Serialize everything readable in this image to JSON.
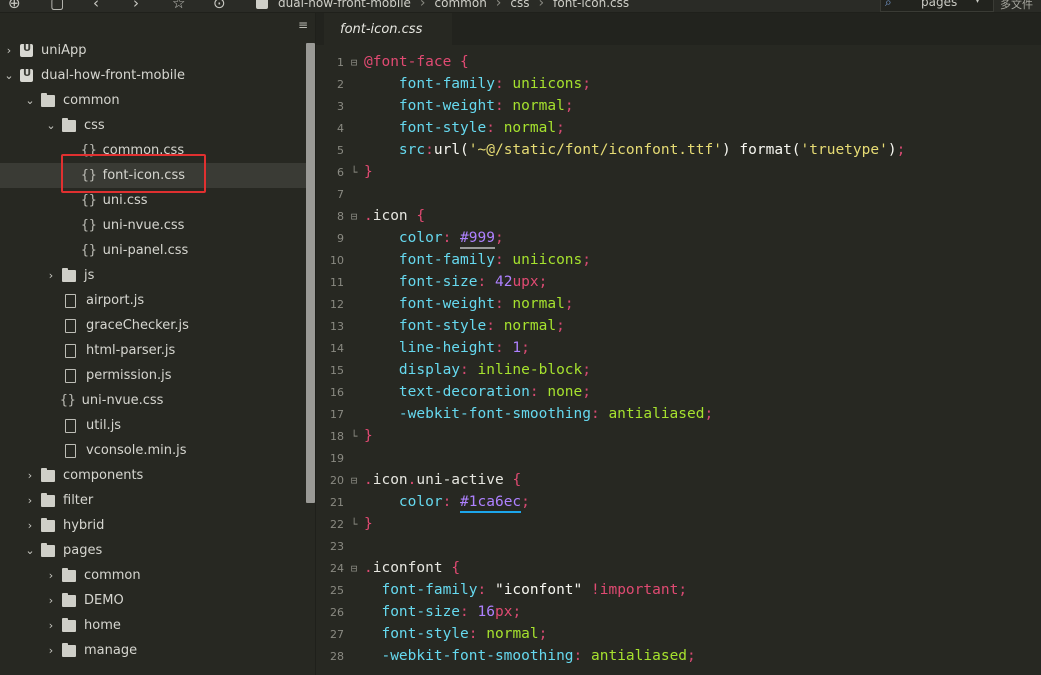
{
  "toolbar": {
    "breadcrumbs": [
      "dual-how-front-mobile",
      "common",
      "css",
      "font-icon.css"
    ],
    "search_scope": "pages",
    "right_label": "多文件搜"
  },
  "sidebar": {
    "tree": [
      {
        "label": "uniApp",
        "type": "project",
        "arrow": "›"
      },
      {
        "label": "dual-how-front-mobile",
        "type": "project",
        "arrow": "⌄"
      },
      {
        "label": "common",
        "type": "folder",
        "arrow": "⌄"
      },
      {
        "label": "css",
        "type": "folder",
        "arrow": "⌄"
      },
      {
        "label": "common.css",
        "type": "css"
      },
      {
        "label": "font-icon.css",
        "type": "css",
        "selected": true
      },
      {
        "label": "uni.css",
        "type": "css"
      },
      {
        "label": "uni-nvue.css",
        "type": "css"
      },
      {
        "label": "uni-panel.css",
        "type": "css"
      },
      {
        "label": "js",
        "type": "folder",
        "arrow": "›"
      },
      {
        "label": "airport.js",
        "type": "file"
      },
      {
        "label": "graceChecker.js",
        "type": "file"
      },
      {
        "label": "html-parser.js",
        "type": "file"
      },
      {
        "label": "permission.js",
        "type": "file"
      },
      {
        "label": "uni-nvue.css",
        "type": "css"
      },
      {
        "label": "util.js",
        "type": "file"
      },
      {
        "label": "vconsole.min.js",
        "type": "file"
      },
      {
        "label": "components",
        "type": "folder",
        "arrow": "›"
      },
      {
        "label": "filter",
        "type": "folder",
        "arrow": "›"
      },
      {
        "label": "hybrid",
        "type": "folder",
        "arrow": "›"
      },
      {
        "label": "pages",
        "type": "folder",
        "arrow": "⌄"
      },
      {
        "label": "common",
        "type": "folder",
        "arrow": "›"
      },
      {
        "label": "DEMO",
        "type": "folder",
        "arrow": "›"
      },
      {
        "label": "home",
        "type": "folder",
        "arrow": "›"
      },
      {
        "label": "manage",
        "type": "folder",
        "arrow": "›"
      }
    ]
  },
  "editor": {
    "tab_label": "font-icon.css",
    "lines": [
      {
        "n": "1",
        "fold": "⊟",
        "t": "@font-face {"
      },
      {
        "n": "2",
        "t": "    font-family: uniicons;"
      },
      {
        "n": "3",
        "t": "    font-weight: normal;"
      },
      {
        "n": "4",
        "t": "    font-style: normal;"
      },
      {
        "n": "5",
        "t": "    src:url('~@/static/font/iconfont.ttf') format('truetype');"
      },
      {
        "n": "6",
        "fold": "└",
        "t": "}"
      },
      {
        "n": "7",
        "t": ""
      },
      {
        "n": "8",
        "fold": "⊟",
        "t": ".icon {"
      },
      {
        "n": "9",
        "t": "    color: #999;"
      },
      {
        "n": "10",
        "t": "    font-family: uniicons;"
      },
      {
        "n": "11",
        "t": "    font-size: 42upx;"
      },
      {
        "n": "12",
        "t": "    font-weight: normal;"
      },
      {
        "n": "13",
        "t": "    font-style: normal;"
      },
      {
        "n": "14",
        "t": "    line-height: 1;"
      },
      {
        "n": "15",
        "t": "    display: inline-block;"
      },
      {
        "n": "16",
        "t": "    text-decoration: none;"
      },
      {
        "n": "17",
        "t": "    -webkit-font-smoothing: antialiased;"
      },
      {
        "n": "18",
        "fold": "└",
        "t": "}"
      },
      {
        "n": "19",
        "t": ""
      },
      {
        "n": "20",
        "fold": "⊟",
        "t": ".icon.uni-active {"
      },
      {
        "n": "21",
        "t": "    color: #1ca6ec;"
      },
      {
        "n": "22",
        "fold": "└",
        "t": "}"
      },
      {
        "n": "23",
        "t": ""
      },
      {
        "n": "24",
        "fold": "⊟",
        "t": ".iconfont {"
      },
      {
        "n": "25",
        "t": "  font-family: \"iconfont\" !important;"
      },
      {
        "n": "26",
        "t": "  font-size: 16px;"
      },
      {
        "n": "27",
        "t": "  font-style: normal;"
      },
      {
        "n": "28",
        "t": "  -webkit-font-smoothing: antialiased;"
      }
    ]
  },
  "colors": {
    "swatch_999": "#999999",
    "swatch_1ca6ec": "#1ca6ec",
    "highlight_box": "#e03030"
  }
}
